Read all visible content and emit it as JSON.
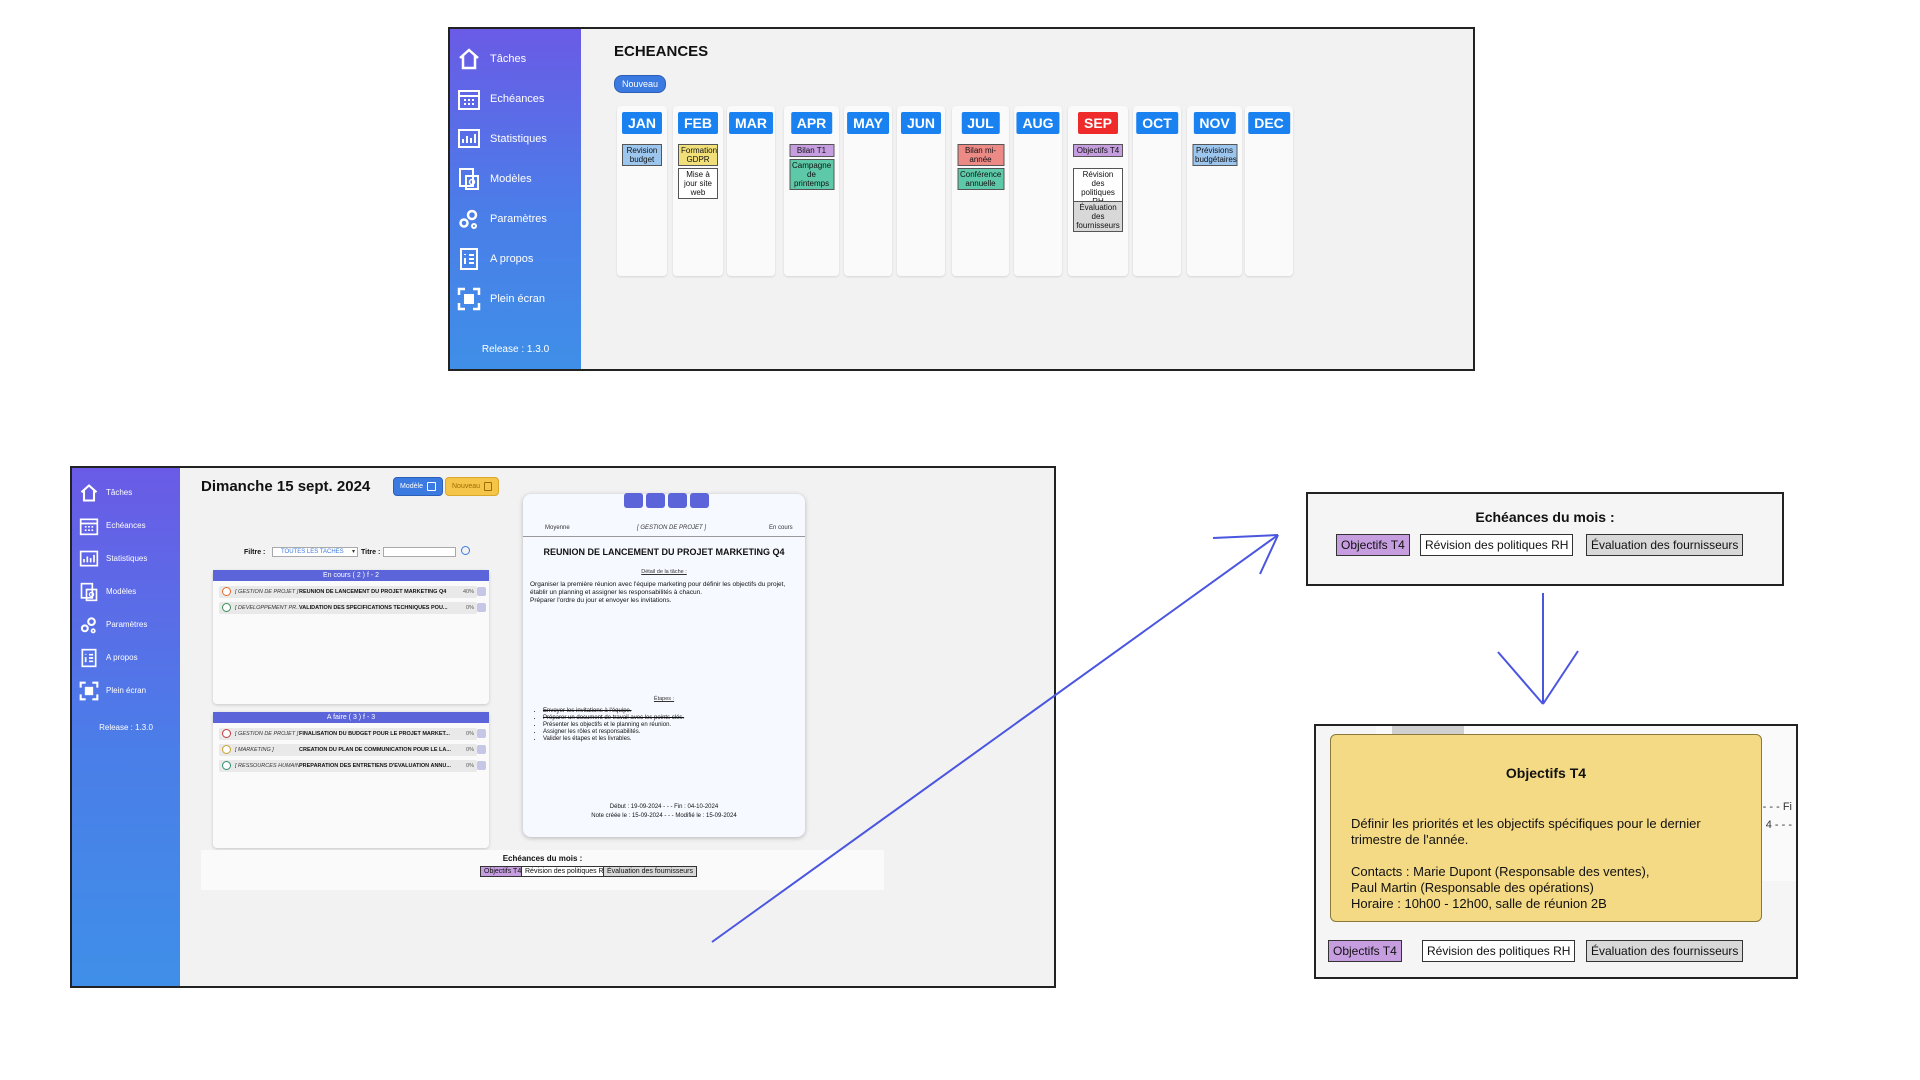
{
  "sidebar": {
    "items": [
      {
        "label": "Tâches",
        "icon": "home-icon"
      },
      {
        "label": "Echéances",
        "icon": "calendar-icon"
      },
      {
        "label": "Statistiques",
        "icon": "chart-icon"
      },
      {
        "label": "Modèles",
        "icon": "template-icon"
      },
      {
        "label": "Paramètres",
        "icon": "gears-icon"
      },
      {
        "label": "A propos",
        "icon": "info-list-icon"
      },
      {
        "label": "Plein écran",
        "icon": "fullscreen-icon"
      }
    ],
    "release": "Release : 1.3.0"
  },
  "echeances": {
    "title": "ECHEANCES",
    "new_button": "Nouveau",
    "months": [
      {
        "label": "JAN",
        "current": false,
        "events": [
          {
            "label": "Revision budget",
            "color": "#9cc6ee"
          }
        ]
      },
      {
        "label": "FEB",
        "current": false,
        "events": [
          {
            "label": "Formation GDPR",
            "color": "#f1e07a"
          },
          {
            "label": "Mise à jour site web",
            "color": "#ffffff"
          }
        ]
      },
      {
        "label": "MAR",
        "current": false,
        "events": []
      },
      {
        "label": "APR",
        "current": false,
        "events": [
          {
            "label": "Bilan T1",
            "color": "#c69ee0"
          },
          {
            "label": "Campagne de printemps",
            "color": "#5ec9a8"
          }
        ]
      },
      {
        "label": "MAY",
        "current": false,
        "events": []
      },
      {
        "label": "JUN",
        "current": false,
        "events": []
      },
      {
        "label": "JUL",
        "current": false,
        "events": [
          {
            "label": "Bilan mi-année",
            "color": "#ec8a86"
          },
          {
            "label": "Conférence annuelle",
            "color": "#5ec9a8"
          }
        ]
      },
      {
        "label": "AUG",
        "current": false,
        "events": []
      },
      {
        "label": "SEP",
        "current": true,
        "events": [
          {
            "label": "Objectifs T4",
            "color": "#c69ee0"
          },
          {
            "label": "Révision des politiques RH",
            "color": "#ffffff"
          },
          {
            "label": "Évaluation des fournisseurs",
            "color": "#d8d8d8"
          }
        ]
      },
      {
        "label": "OCT",
        "current": false,
        "events": []
      },
      {
        "label": "NOV",
        "current": false,
        "events": [
          {
            "label": "Prévisions budgétaires",
            "color": "#9cc6ee"
          }
        ]
      },
      {
        "label": "DEC",
        "current": false,
        "events": []
      }
    ]
  },
  "tasks_view": {
    "date": "Dimanche 15 sept. 2024",
    "model_button": "Modèle",
    "new_button": "Nouveau",
    "filter_label": "Filtre :",
    "filter_value": "TOUTES LES TACHES",
    "title_label": "Titre :",
    "en_cours": {
      "header": "En cours ( 2 )  f - 2",
      "rows": [
        {
          "tag": "[ GESTION DE PROJET ]",
          "title": "REUNION DE LANCEMENT DU PROJET MARKETING Q4",
          "pct": "40%"
        },
        {
          "tag": "[ DEVELOPPEMENT PR...",
          "title": "VALIDATION DES SPECIFICATIONS TECHNIQUES POU...",
          "pct": "0%"
        }
      ]
    },
    "a_faire": {
      "header": "A faire ( 3 )  f - 3",
      "rows": [
        {
          "tag": "[ GESTION DE PROJET ]",
          "title": "FINALISATION DU BUDGET POUR LE PROJET MARKET...",
          "pct": "0%"
        },
        {
          "tag": "[ MARKETING ]",
          "title": "CREATION DU PLAN DE COMMUNICATION POUR LE LA...",
          "pct": "0%"
        },
        {
          "tag": "[ RESSOURCES HUMAIN",
          "title": "PREPARATION DES ENTRETIENS D'EVALUATION ANNU...",
          "pct": "0%"
        }
      ]
    },
    "detail": {
      "priority": "Moyenne",
      "category": "[ GESTION DE PROJET ]",
      "status": "En cours",
      "title": "REUNION DE LANCEMENT DU PROJET MARKETING Q4",
      "detail_label": "Détail de la tâche :",
      "description_1": "Organiser la première réunion avec l'équipe marketing pour définir les objectifs du projet, établir un planning et assigner les responsabilités à chacun.",
      "description_2": "Préparer l'ordre du jour et envoyer les invitations.",
      "steps_label": "Étapes :",
      "steps": [
        {
          "text": "Envoyer les invitations à l'équipe.",
          "done": true
        },
        {
          "text": "Préparer un document de travail avec les points clés.",
          "done": true
        },
        {
          "text": "Présenter les objectifs et le planning en réunion.",
          "done": false
        },
        {
          "text": "Assigner les rôles et responsabilités.",
          "done": false
        },
        {
          "text": "Valider les étapes et les livrables.",
          "done": false
        }
      ],
      "dates_line_1": "Début : 19-09-2024 - - - Fin : 04-10-2024",
      "dates_line_2": "Note créée le : 15-09-2024 - - - Modifié le : 15-09-2024"
    },
    "month_deadlines_label": "Echéances du mois :",
    "month_deadlines": [
      {
        "label": "Objectifs T4",
        "color": "#c69ee0"
      },
      {
        "label": "Révision des politiques RH",
        "color": "#ffffff"
      },
      {
        "label": "Évaluation des fournisseurs",
        "color": "#d8d8d8"
      }
    ]
  },
  "tooltip": {
    "title": "Objectifs T4",
    "line_1": "Définir les priorités et les objectifs spécifiques pour le dernier trimestre de l'année.",
    "line_2": "Contacts : Marie Dupont (Responsable des ventes),",
    "line_3": "Paul Martin (Responsable des opérations)",
    "line_4": "Horaire : 10h00 - 12h00, salle de réunion 2B",
    "edge_text_1": "- - - Fi",
    "edge_text_2": "4 - - -"
  },
  "colors": {
    "accent": "#5b64d8",
    "month_current": "#ee2a2a",
    "month_default": "#1a82f0",
    "tooltip_bg": "#f4da84"
  }
}
